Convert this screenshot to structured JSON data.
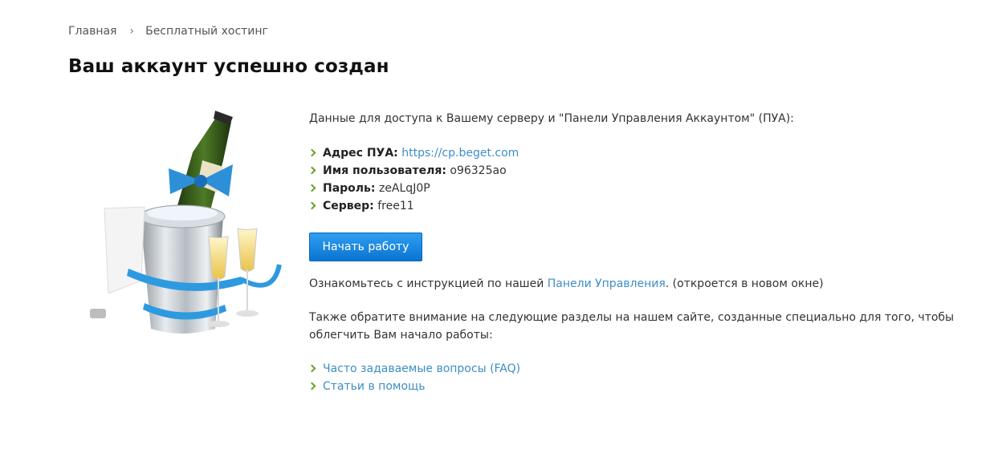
{
  "breadcrumb": {
    "home": "Главная",
    "separator": "›",
    "current": "Бесплатный хостинг"
  },
  "page_title": "Ваш аккаунт успешно создан",
  "intro": "Данные для доступа к Вашему серверу и \"Панели Управления Аккаунтом\" (ПУА):",
  "credentials": {
    "panel_label": "Адрес ПУА:",
    "panel_url": "https://cp.beget.com",
    "user_label": "Имя пользователя:",
    "user_value": "o96325ao",
    "pass_label": "Пароль:",
    "pass_value": "zeALqJ0P",
    "server_label": "Сервер:",
    "server_value": "free11"
  },
  "start_button": "Начать работу",
  "instructions": {
    "before": "Ознакомьтесь с инструкцией по нашей ",
    "link": "Панели Управления",
    "after": ". (откроется в новом окне)"
  },
  "also_note": "Также обратите внимание на следующие разделы на нашем сайте, созданные специально для того, чтобы облегчить Вам начало работы:",
  "help_links": {
    "faq": "Часто задаваемые вопросы (FAQ)",
    "articles": "Статьи в помощь"
  },
  "colors": {
    "accent_link": "#3d8ec4",
    "bullet": "#6aa22c",
    "button": "#1a86e0"
  }
}
